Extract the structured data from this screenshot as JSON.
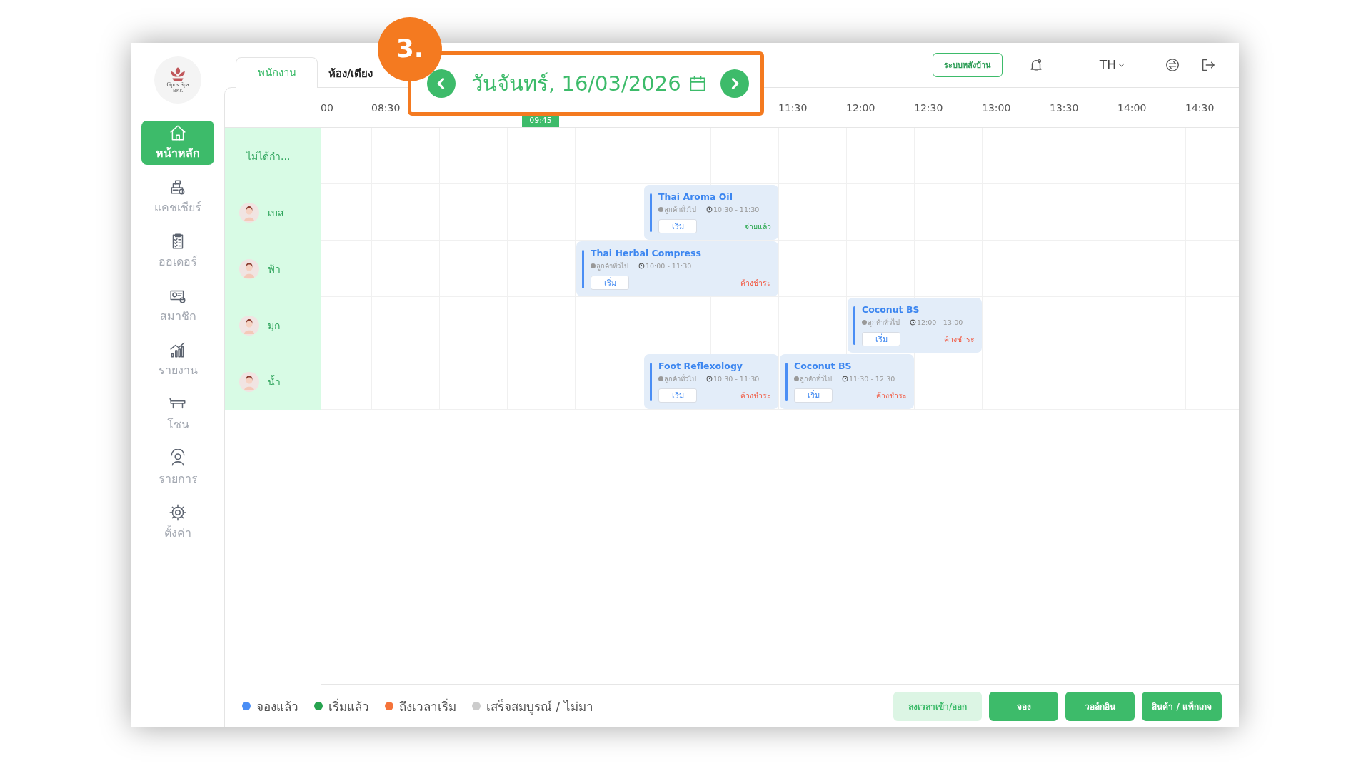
{
  "logo": {
    "name": "Gpos Spa",
    "sub": "BKK"
  },
  "sidebar": {
    "items": [
      {
        "label": "หน้าหลัก",
        "selected": true
      },
      {
        "label": "แคชเชียร์",
        "selected": false
      },
      {
        "label": "ออเดอร์",
        "selected": false
      },
      {
        "label": "สมาชิก",
        "selected": false
      },
      {
        "label": "รายงาน",
        "selected": false
      },
      {
        "label": "โซน",
        "selected": false
      },
      {
        "label": "รายการ",
        "selected": false
      },
      {
        "label": "ตั้งค่า",
        "selected": false
      }
    ]
  },
  "tabs": [
    {
      "label": "พนักงาน",
      "selected": true
    },
    {
      "label": "ห้อง/เตียง",
      "selected": false
    }
  ],
  "step_marker": "3.",
  "date_nav": {
    "date": "วันจันทร์, 16/03/2026"
  },
  "header": {
    "backoffice_button": "ระบบหลังบ้าน",
    "language": "TH"
  },
  "timeline": {
    "labels_before_date": [
      "00",
      "08:30"
    ],
    "labels_after_date": [
      "11:30",
      "12:00",
      "12:30",
      "13:00",
      "13:30",
      "14:00",
      "14:30"
    ],
    "now": "09:45"
  },
  "rows": [
    {
      "kind": "unassigned",
      "name": "ไม่ได้กำ..."
    },
    {
      "kind": "staff",
      "name": "เบส",
      "bookings": [
        {
          "service": "Thai Aroma Oil",
          "customer": "ลูกค้าทั่วไป",
          "time": "10:30 - 11:30",
          "button": "เริ่ม",
          "payment": "จ่ายแล้ว",
          "paid": true
        }
      ]
    },
    {
      "kind": "staff",
      "name": "ฟ้า",
      "bookings": [
        {
          "service": "Thai Herbal Compress",
          "customer": "ลูกค้าทั่วไป",
          "time": "10:00 - 11:30",
          "button": "เริ่ม",
          "payment": "ค้างชำระ",
          "paid": false
        }
      ]
    },
    {
      "kind": "staff",
      "name": "มุก",
      "bookings": [
        {
          "service": "Coconut BS",
          "customer": "ลูกค้าทั่วไป",
          "time": "12:00 - 13:00",
          "button": "เริ่ม",
          "payment": "ค้างชำระ",
          "paid": false
        }
      ]
    },
    {
      "kind": "staff",
      "name": "น้ำ",
      "bookings": [
        {
          "service": "Foot Reflexology",
          "customer": "ลูกค้าทั่วไป",
          "time": "10:30 - 11:30",
          "button": "เริ่ม",
          "payment": "ค้างชำระ",
          "paid": false
        },
        {
          "service": "Coconut BS",
          "customer": "ลูกค้าทั่วไป",
          "time": "11:30 - 12:30",
          "button": "เริ่ม",
          "payment": "ค้างชำระ",
          "paid": false
        }
      ]
    }
  ],
  "legend": [
    {
      "label": "จองแล้ว",
      "color": "#4a8ef5"
    },
    {
      "label": "เริ่มแล้ว",
      "color": "#27a34f"
    },
    {
      "label": "ถึงเวลาเริ่ม",
      "color": "#f5733a"
    },
    {
      "label": "เสร็จสมบูรณ์ / ไม่มา",
      "color": "#cccccc"
    }
  ],
  "actions": [
    {
      "label": "ลงเวลาเข้า/ออก",
      "kind": "secondary"
    },
    {
      "label": "จอง",
      "kind": "primary"
    },
    {
      "label": "วอล์กอิน",
      "kind": "primary"
    },
    {
      "label": "สินค้า / แพ็กเกจ",
      "kind": "primary"
    }
  ]
}
